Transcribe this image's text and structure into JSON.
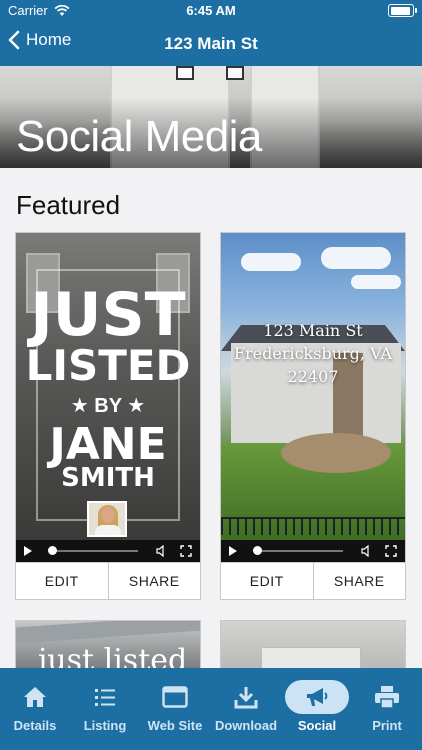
{
  "status_bar": {
    "carrier": "Carrier",
    "time": "6:45 AM",
    "battery_level": 0.95
  },
  "nav": {
    "back_label": "Home",
    "title": "123 Main St"
  },
  "hero": {
    "heading": "Social Media"
  },
  "section": {
    "title": "Featured"
  },
  "cards": [
    {
      "lines": [
        "JUST",
        "LISTED",
        "BY",
        "JANE",
        "SMITH"
      ],
      "edit_label": "EDIT",
      "share_label": "SHARE"
    },
    {
      "address_lines": [
        "123 Main St",
        "Fredericksburg, VA",
        "22407"
      ],
      "edit_label": "EDIT",
      "share_label": "SHARE"
    }
  ],
  "peek_cards": [
    {
      "text": "just listed"
    }
  ],
  "tabs": [
    {
      "label": "Details",
      "icon": "home-icon",
      "active": false
    },
    {
      "label": "Listing",
      "icon": "list-icon",
      "active": false
    },
    {
      "label": "Web Site",
      "icon": "browser-icon",
      "active": false
    },
    {
      "label": "Download",
      "icon": "download-icon",
      "active": false
    },
    {
      "label": "Social",
      "icon": "megaphone-icon",
      "active": true
    },
    {
      "label": "Print",
      "icon": "printer-icon",
      "active": false
    }
  ],
  "colors": {
    "brand": "#1d6fa3",
    "active_pill": "#cbe3f5"
  }
}
